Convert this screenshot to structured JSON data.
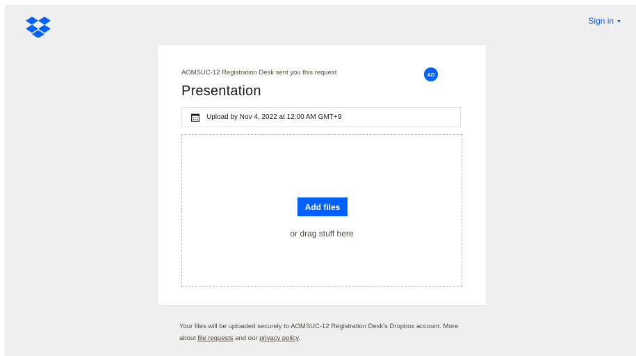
{
  "header": {
    "logo_icon": "dropbox-logo-icon",
    "signin_label": "Sign in",
    "signin_caret_icon": "caret-down-icon"
  },
  "request": {
    "sender_text": "AOMSUC-12 Registration Desk sent you this request",
    "avatar_initials": "AD",
    "title": "Presentation",
    "deadline_icon": "calendar-icon",
    "deadline_text": "Upload by Nov 4, 2022 at 12:00 AM GMT+9"
  },
  "dropzone": {
    "add_button_label": "Add files",
    "drag_text": "or drag stuff here"
  },
  "footer": {
    "text_part1": "Your files will be uploaded securely to AOMSUC-12 Registration Desk's Dropbox account. More about ",
    "link1": "file requests",
    "text_part2": " and our ",
    "link2": "privacy policy",
    "text_part3": "."
  },
  "colors": {
    "brand_blue": "#0061fe",
    "page_background": "#f0efef",
    "card_background": "#ffffff"
  }
}
